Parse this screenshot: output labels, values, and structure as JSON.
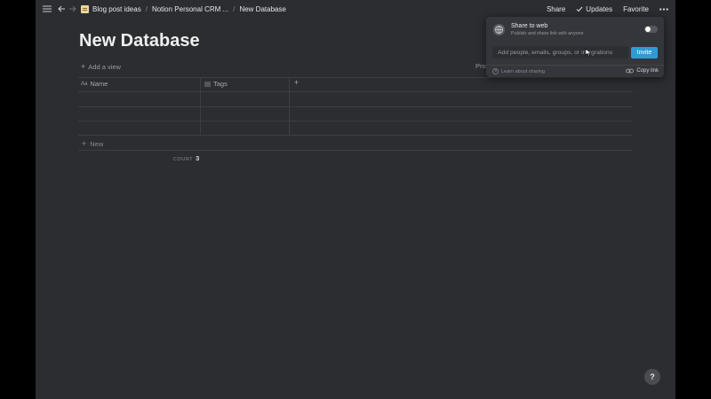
{
  "topbar": {
    "breadcrumbs": [
      "Blog post ideas",
      "Notion Personal CRM ...",
      "New Database"
    ],
    "share_label": "Share",
    "updates_label": "Updates",
    "favorite_label": "Favorite"
  },
  "page": {
    "title": "New Database",
    "add_view_label": "Add a view",
    "properties_partial": "Pro"
  },
  "table": {
    "columns": [
      "Name",
      "Tags"
    ],
    "add_column_symbol": "+",
    "rows": [
      [
        "",
        ""
      ],
      [
        "",
        ""
      ],
      [
        "",
        ""
      ]
    ],
    "new_row_label": "New",
    "count_label": "COUNT",
    "count_value": "3"
  },
  "share_popup": {
    "title": "Share to web",
    "subtitle": "Publish and share link with anyone",
    "toggle_on": false,
    "input_placeholder": "Add people, emails, groups, or integrations",
    "invite_label": "Invite",
    "learn_label": "Learn about sharing",
    "copy_link_label": "Copy link",
    "accent_color": "#2e9bd6"
  },
  "help_label": "?"
}
